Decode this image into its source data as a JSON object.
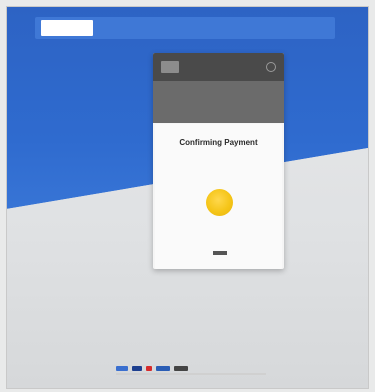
{
  "banner": {
    "logo_top": "",
    "logo_bottom": "",
    "text": ""
  },
  "device": {
    "merchant_text": "",
    "payment_title": "",
    "row_left": "",
    "row_right": ""
  },
  "card": {
    "title": "Confirming Payment",
    "subtitle": "",
    "powered_by": ""
  },
  "footer": {
    "right_text": ""
  },
  "colors": {
    "sky_blue": "#2f6bcf",
    "banner_blue": "#3f78d6",
    "spinner_yellow": "#f5c518"
  }
}
